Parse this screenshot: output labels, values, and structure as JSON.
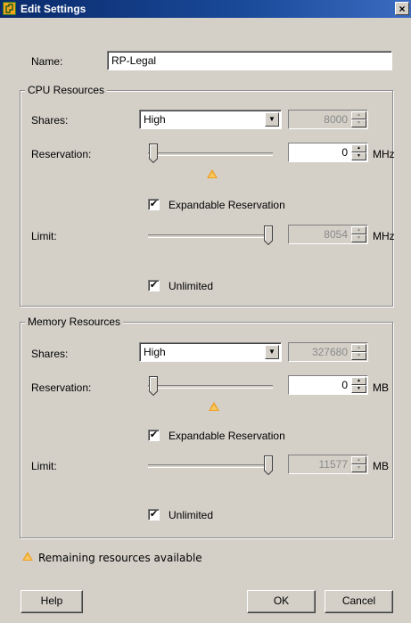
{
  "window": {
    "title": "Edit Settings",
    "close_glyph": "×",
    "icon": "app-settings-icon"
  },
  "name_field": {
    "label": "Name:",
    "value": "RP-Legal"
  },
  "cpu": {
    "group_title": "CPU Resources",
    "shares_label": "Shares:",
    "shares_value": "High",
    "shares_number": "8000",
    "reservation_label": "Reservation:",
    "reservation_value": "0",
    "reservation_unit": "MHz",
    "expandable_label": "Expandable Reservation",
    "expandable_checked": true,
    "limit_label": "Limit:",
    "limit_value": "8054",
    "limit_unit": "MHz",
    "unlimited_label": "Unlimited",
    "unlimited_checked": true
  },
  "memory": {
    "group_title": "Memory Resources",
    "shares_label": "Shares:",
    "shares_value": "High",
    "shares_number": "327680",
    "reservation_label": "Reservation:",
    "reservation_value": "0",
    "reservation_unit": "MB",
    "expandable_label": "Expandable Reservation",
    "expandable_checked": true,
    "limit_label": "Limit:",
    "limit_value": "11577",
    "limit_unit": "MB",
    "unlimited_label": "Unlimited",
    "unlimited_checked": true
  },
  "legend": {
    "text": "Remaining resources available",
    "icon": "warning-triangle-icon"
  },
  "buttons": {
    "help": "Help",
    "ok": "OK",
    "cancel": "Cancel"
  },
  "colors": {
    "titlebar": "#0a2a6b",
    "warning": "#f0a020",
    "dialog_bg": "#d4d0c8"
  }
}
